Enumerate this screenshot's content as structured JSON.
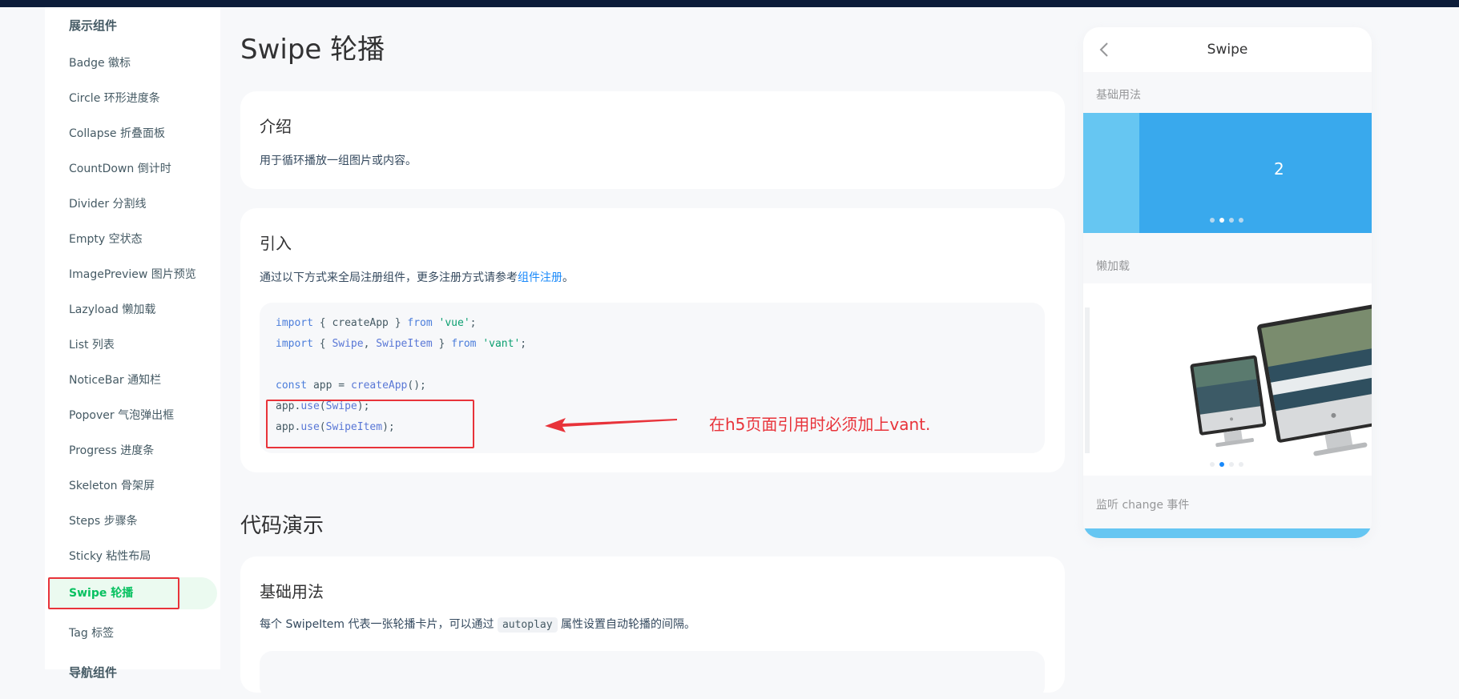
{
  "sidebar": {
    "group_title": "展示组件",
    "items": [
      {
        "label": "Badge 徽标"
      },
      {
        "label": "Circle 环形进度条"
      },
      {
        "label": "Collapse 折叠面板"
      },
      {
        "label": "CountDown 倒计时"
      },
      {
        "label": "Divider 分割线"
      },
      {
        "label": "Empty 空状态"
      },
      {
        "label": "ImagePreview 图片预览"
      },
      {
        "label": "Lazyload 懒加载"
      },
      {
        "label": "List 列表"
      },
      {
        "label": "NoticeBar 通知栏"
      },
      {
        "label": "Popover 气泡弹出框"
      },
      {
        "label": "Progress 进度条"
      },
      {
        "label": "Skeleton 骨架屏"
      },
      {
        "label": "Steps 步骤条"
      },
      {
        "label": "Sticky 粘性布局"
      },
      {
        "label": "Swipe 轮播"
      },
      {
        "label": "Tag 标签"
      }
    ],
    "active_item": "Swipe 轮播",
    "next_group_title": "导航组件"
  },
  "main": {
    "title": "Swipe 轮播",
    "intro": {
      "heading": "介绍",
      "text": "用于循环播放一组图片或内容。"
    },
    "import_section": {
      "heading": "引入",
      "text_before": "通过以下方式来全局注册组件，更多注册方式请参考",
      "link": "组件注册",
      "text_after": "。",
      "code": {
        "line1": {
          "kw1": "import",
          "mid1": " { createApp } ",
          "kw2": "from",
          "sp": " ",
          "str": "'vue'",
          "end": ";"
        },
        "line2": {
          "kw1": "import",
          "a": " { ",
          "cls1": "Swipe",
          "b": ", ",
          "cls2": "SwipeItem",
          "c": " } ",
          "kw2": "from",
          "sp": " ",
          "str": "'vant'",
          "end": ";"
        },
        "line4": {
          "kw": "const",
          "mid": " app = ",
          "fn": "createApp",
          "end": "();"
        },
        "line5": {
          "obj": "app.",
          "fn": "use",
          "open": "(",
          "arg": "Swipe",
          "end": ");"
        },
        "line6": {
          "obj": "app.",
          "fn": "use",
          "open": "(",
          "arg": "SwipeItem",
          "end": ");"
        }
      }
    },
    "annotation": "在h5页面引用时必须加上vant.",
    "demo_section_title": "代码演示",
    "basic": {
      "heading": "基础用法",
      "text_before": "每个 SwipeItem 代表一张轮播卡片，可以通过",
      "code": "autoplay",
      "text_after": "属性设置自动轮播的间隔。"
    }
  },
  "preview": {
    "title": "Swipe",
    "demo1_label": "基础用法",
    "demo1_slide": "2",
    "demo2_label": "懒加载",
    "demo3_label": "监听 change 事件"
  },
  "colors": {
    "accent": "#07c160",
    "link": "#1989fa",
    "highlight_red": "#e8333a",
    "swipe_blue": "#39a9ed"
  }
}
